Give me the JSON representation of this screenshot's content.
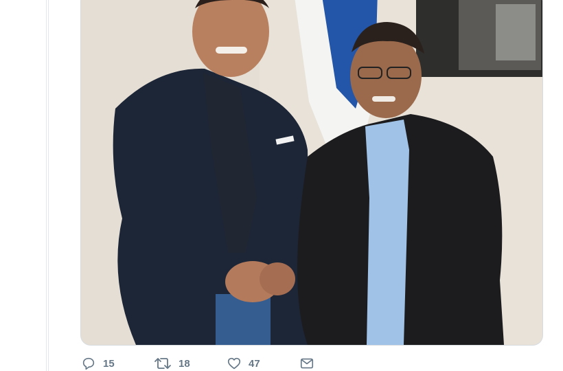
{
  "tweet": {
    "actions": [
      {
        "name": "reply",
        "icon": "reply-icon",
        "count": "15"
      },
      {
        "name": "retweet",
        "icon": "retweet-icon",
        "count": "18"
      },
      {
        "name": "like",
        "icon": "heart-icon",
        "count": "47"
      },
      {
        "name": "message",
        "icon": "envelope-icon",
        "count": ""
      }
    ]
  },
  "colors": {
    "action_gray": "#657786",
    "divider": "#e1e8ed"
  }
}
